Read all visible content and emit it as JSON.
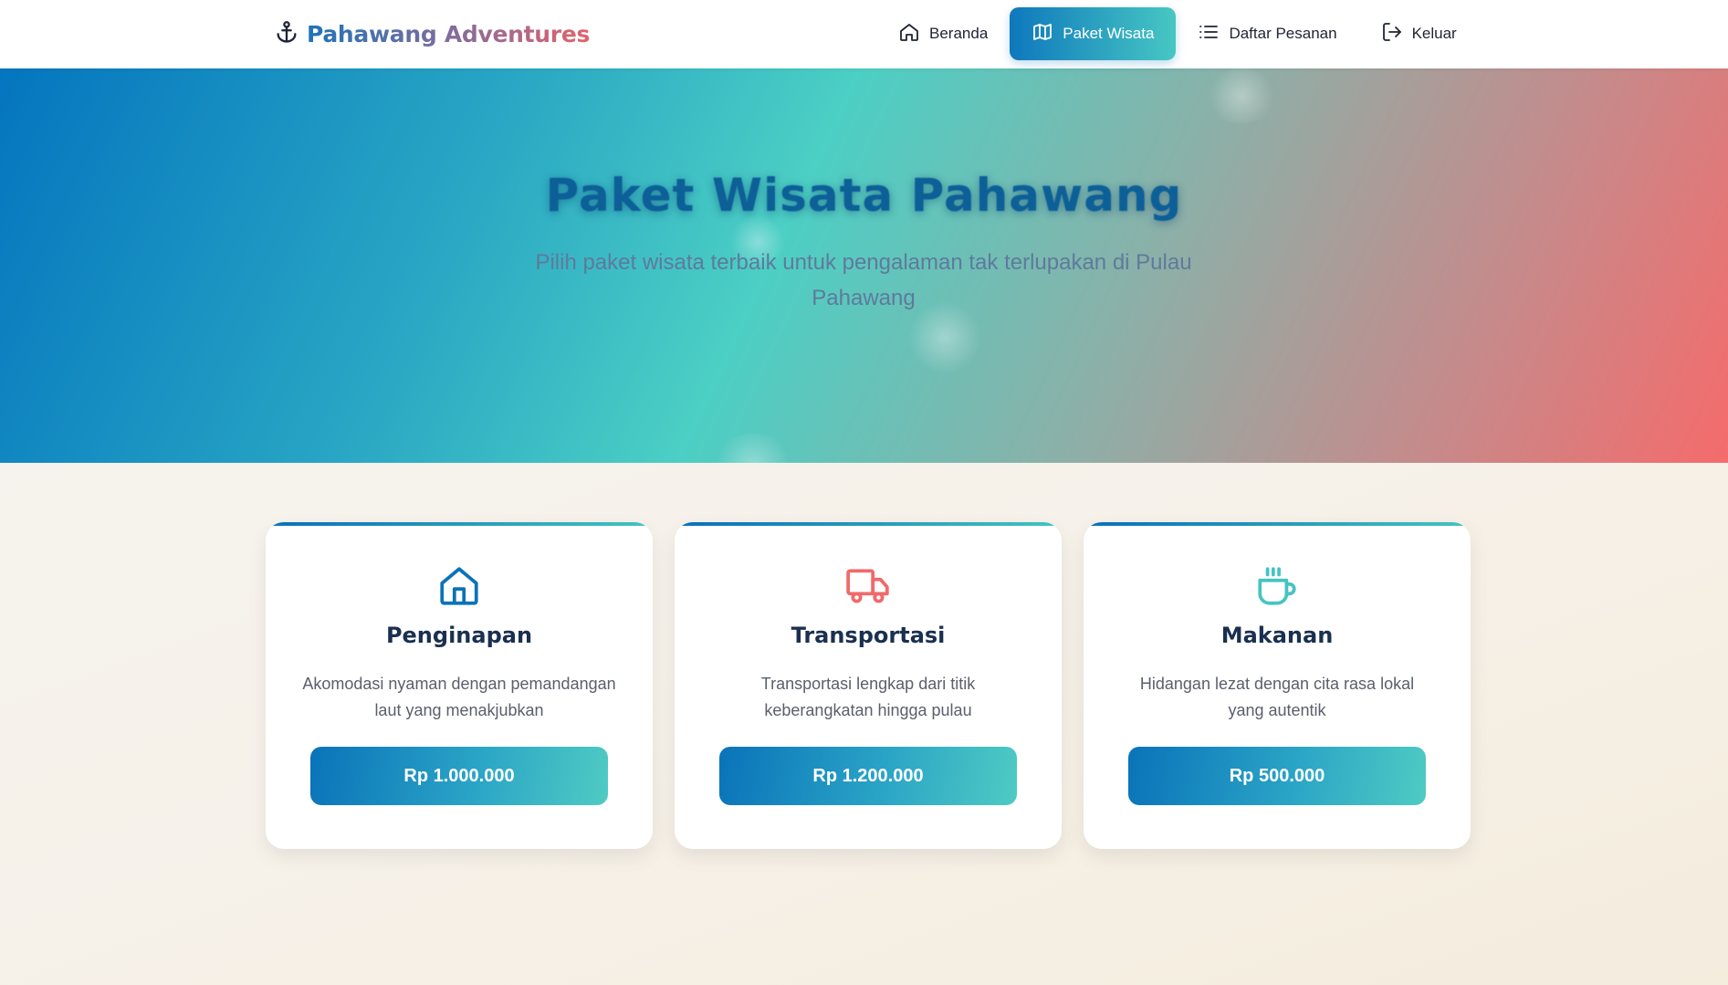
{
  "brand": {
    "name": "Pahawang Adventures",
    "icon": "anchor-icon"
  },
  "nav": {
    "items": [
      {
        "label": "Beranda",
        "icon": "home-icon",
        "active": false
      },
      {
        "label": "Paket Wisata",
        "icon": "map-icon",
        "active": true
      },
      {
        "label": "Daftar Pesanan",
        "icon": "list-icon",
        "active": false
      },
      {
        "label": "Keluar",
        "icon": "logout-icon",
        "active": false
      }
    ]
  },
  "hero": {
    "title": "Paket Wisata Pahawang",
    "subtitle": "Pilih paket wisata terbaik untuk pengalaman tak terlupakan di Pulau Pahawang"
  },
  "packages": [
    {
      "title": "Penginapan",
      "description": "Akomodasi nyaman dengan pemandangan laut yang menakjubkan",
      "price": "Rp 1.000.000",
      "icon": "house-icon",
      "icon_color": "#0b72b8"
    },
    {
      "title": "Transportasi",
      "description": "Transportasi lengkap dari titik keberangkatan hingga pulau",
      "price": "Rp 1.200.000",
      "icon": "truck-icon",
      "icon_color": "#f06a6a"
    },
    {
      "title": "Makanan",
      "description": "Hidangan lezat dengan cita rasa lokal yang autentik",
      "price": "Rp 500.000",
      "icon": "coffee-cup-icon",
      "icon_color": "#46c4c0"
    }
  ],
  "colors": {
    "accent": "#0e78bd",
    "accent_light": "#47c7c3",
    "coral": "#f56b6b"
  }
}
